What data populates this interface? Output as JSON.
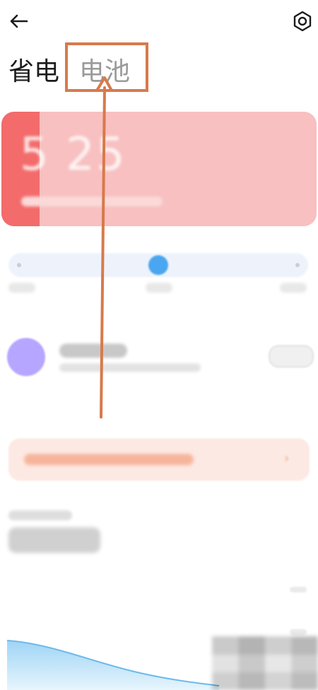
{
  "header": {
    "back_icon": "back-arrow-icon",
    "settings_icon": "gear-icon"
  },
  "tabs": [
    {
      "label": "省电"
    },
    {
      "label": "电池"
    }
  ],
  "battery": {
    "level_percent": 12
  },
  "mode_slider": {
    "position_percent": 50
  },
  "colors": {
    "accent": "#d77a4b",
    "battery_card": "#f8c0c0",
    "battery_level": "#f36b6b",
    "slider_knob": "#4aa6f0",
    "ultra_icon": "#b6a6ff",
    "banner_bg": "#fde9e3"
  }
}
